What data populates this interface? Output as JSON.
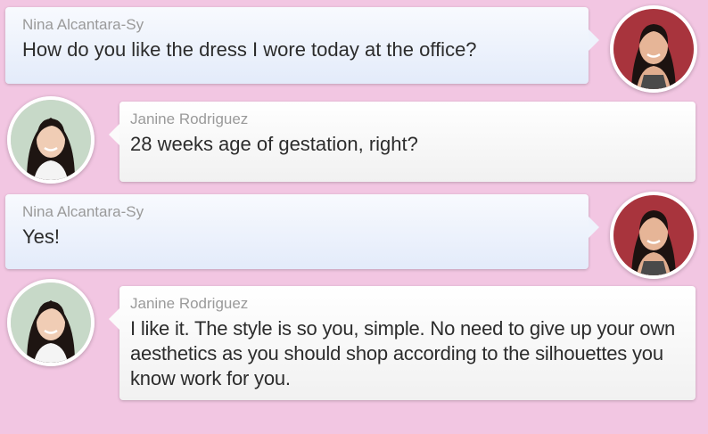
{
  "conversation": {
    "messages": [
      {
        "sender": "Nina Alcantara-Sy",
        "direction": "sent",
        "avatar_icon": "nina-avatar",
        "text": "How do you like the dress I wore today at the office?"
      },
      {
        "sender": "Janine Rodriguez",
        "direction": "received",
        "avatar_icon": "janine-avatar",
        "text": "28 weeks age of gestation, right?"
      },
      {
        "sender": "Nina Alcantara-Sy",
        "direction": "sent",
        "avatar_icon": "nina-avatar",
        "text": "Yes!"
      },
      {
        "sender": "Janine Rodriguez",
        "direction": "received",
        "avatar_icon": "janine-avatar",
        "text": "I like it. The style is so you, simple. No need to give up your own aesthetics as you should shop according to the silhouettes you know work for you."
      }
    ]
  },
  "colors": {
    "background": "#f2c6e2",
    "sent_bubble": "#e3ebfa",
    "received_bubble": "#f1f1f1",
    "name_text": "#9a9a9a",
    "message_text": "#2c2c2c"
  }
}
